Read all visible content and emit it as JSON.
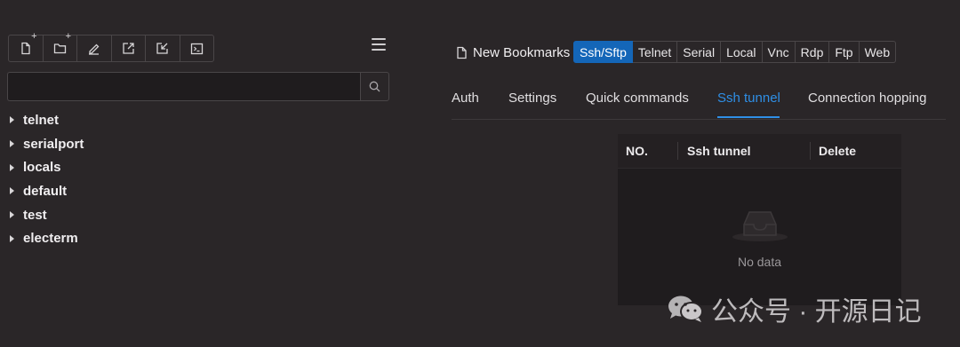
{
  "toolbar": {
    "buttons": [
      {
        "name": "new-bookmark",
        "icon": "file-plus-icon"
      },
      {
        "name": "new-folder",
        "icon": "folder-plus-icon"
      },
      {
        "name": "edit",
        "icon": "pencil-icon"
      },
      {
        "name": "import",
        "icon": "import-icon"
      },
      {
        "name": "export",
        "icon": "export-icon"
      },
      {
        "name": "terminal",
        "icon": "terminal-icon"
      }
    ],
    "plus_glyph": "+"
  },
  "search": {
    "value": "",
    "placeholder": "",
    "icon": "search-icon"
  },
  "tree": {
    "items": [
      {
        "label": "telnet"
      },
      {
        "label": "serialport"
      },
      {
        "label": "locals"
      },
      {
        "label": "default"
      },
      {
        "label": "test"
      },
      {
        "label": "electerm"
      }
    ]
  },
  "bookmark": {
    "title": "New Bookmarks",
    "protocols": [
      "Ssh/Sftp",
      "Telnet",
      "Serial",
      "Local",
      "Vnc",
      "Rdp",
      "Ftp",
      "Web"
    ],
    "active_protocol": "Ssh/Sftp"
  },
  "tabs": {
    "items": [
      "Auth",
      "Settings",
      "Quick commands",
      "Ssh tunnel",
      "Connection hopping"
    ],
    "active": "Ssh tunnel"
  },
  "table": {
    "columns": [
      "NO.",
      "Ssh tunnel",
      "Delete"
    ],
    "rows": [],
    "empty_text": "No data"
  },
  "watermark": {
    "text": "公众号 · 开源日记",
    "icon": "wechat-icon"
  },
  "colors": {
    "background": "#2a2628",
    "accent": "#1466b8",
    "tab_active": "#2f8fe6",
    "panel": "#1f1c1e"
  }
}
